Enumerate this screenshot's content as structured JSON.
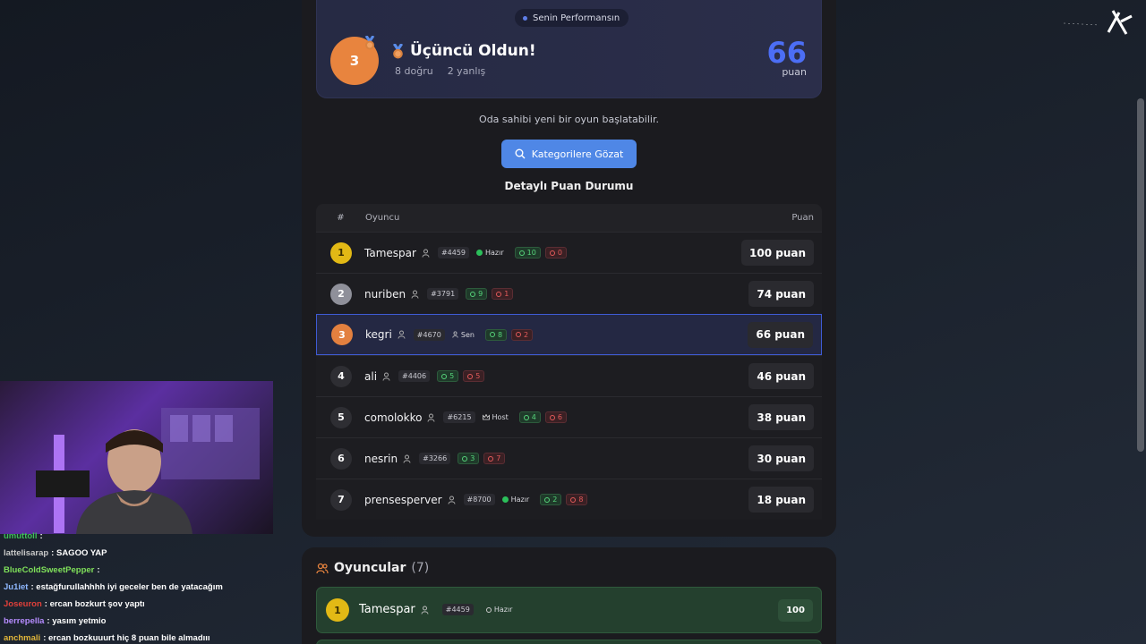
{
  "performance": {
    "pill_label": "Senin Performansın",
    "rank": "3",
    "title": "Üçüncü Oldun!",
    "correct": "8 doğru",
    "wrong": "2 yanlış",
    "score": "66",
    "score_unit": "puan"
  },
  "owner_message": "Oda sahibi yeni bir oyun başlatabilir.",
  "browse_button": "Kategorilere Gözat",
  "detail_title": "Detaylı Puan Durumu",
  "table": {
    "headers": {
      "rank": "#",
      "player": "Oyuncu",
      "score": "Puan"
    },
    "rows": [
      {
        "rank": "1",
        "name": "Tamespar",
        "tag": "#4459",
        "status": "Hazır",
        "correct": "10",
        "wrong": "0",
        "score": "100 puan"
      },
      {
        "rank": "2",
        "name": "nuriben",
        "tag": "#3791",
        "status": "",
        "correct": "9",
        "wrong": "1",
        "score": "74 puan"
      },
      {
        "rank": "3",
        "name": "kegri",
        "tag": "#4670",
        "status": "Sen",
        "correct": "8",
        "wrong": "2",
        "score": "66 puan"
      },
      {
        "rank": "4",
        "name": "ali",
        "tag": "#4406",
        "status": "",
        "correct": "5",
        "wrong": "5",
        "score": "46 puan"
      },
      {
        "rank": "5",
        "name": "comolokko",
        "tag": "#6215",
        "status": "Host",
        "correct": "4",
        "wrong": "6",
        "score": "38 puan"
      },
      {
        "rank": "6",
        "name": "nesrin",
        "tag": "#3266",
        "status": "",
        "correct": "3",
        "wrong": "7",
        "score": "30 puan"
      },
      {
        "rank": "7",
        "name": "prensesperver",
        "tag": "#8700",
        "status": "Hazır",
        "correct": "2",
        "wrong": "8",
        "score": "18 puan"
      }
    ]
  },
  "players": {
    "title": "Oyuncular",
    "count": "(7)",
    "first": {
      "rank": "1",
      "name": "Tamespar",
      "tag": "#4459",
      "status": "Hazır",
      "score": "100"
    }
  },
  "chat": [
    {
      "user": "umuttoll",
      "text": "",
      "color": "#3fbf5a"
    },
    {
      "user": "lattelisarap",
      "text": "SAGOO YAP",
      "color": "#c9c9c9"
    },
    {
      "user": "BlueColdSweetPepper",
      "text": "",
      "color": "#7fe05a"
    },
    {
      "user": "Ju1iet",
      "text": "estağfurullahhhh iyi geceler ben de yatacağım",
      "color": "#8fb8ff"
    },
    {
      "user": "Joseuron",
      "text": "ercan bozkurt şov yaptı",
      "color": "#e0403a"
    },
    {
      "user": "berrepella",
      "text": "yasım yetmio",
      "color": "#b68cff"
    },
    {
      "user": "anchmali",
      "text": "ercan bozkuuurt hiç 8 puan bile almadııı",
      "color": "#e0b53a"
    }
  ],
  "colors": {
    "accent": "#4c6ef5",
    "button": "#4f87e6",
    "gold": "#e2b915",
    "bronze": "#e3803f",
    "silver": "#8f909a"
  }
}
